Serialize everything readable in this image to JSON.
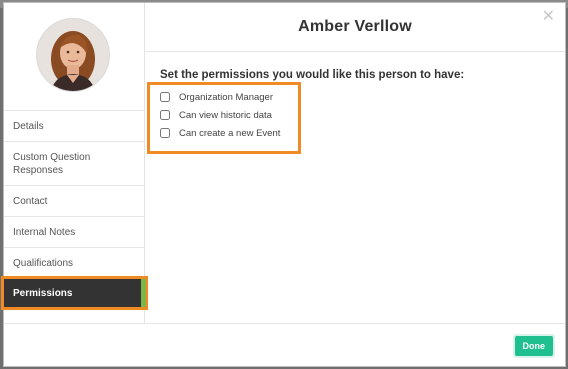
{
  "person": {
    "name": "Amber Verllow"
  },
  "sidebar": {
    "items": [
      {
        "label": "Details"
      },
      {
        "label": "Custom Question Responses"
      },
      {
        "label": "Contact"
      },
      {
        "label": "Internal Notes"
      },
      {
        "label": "Qualifications"
      },
      {
        "label": "Permissions",
        "active": true
      }
    ]
  },
  "permissions": {
    "prompt": "Set the permissions you would like this person to have:",
    "options": [
      {
        "label": "Organization Manager",
        "checked": false
      },
      {
        "label": "Can view historic data",
        "checked": false
      },
      {
        "label": "Can create a new Event",
        "checked": false
      }
    ]
  },
  "footer": {
    "done_label": "Done"
  },
  "colors": {
    "highlight": "#f08a24",
    "active_nav_bg": "#333333",
    "active_accent": "#7ab648",
    "done_button": "#1fbf8f"
  },
  "icons": {
    "close": "close-icon"
  }
}
